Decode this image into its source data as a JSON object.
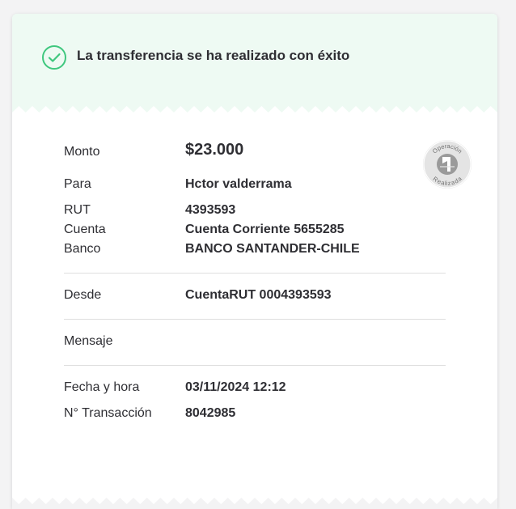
{
  "header": {
    "message": "La transferencia se ha realizado con éxito"
  },
  "stamp": {
    "top_text": "Operación",
    "bottom_text": "Realizada"
  },
  "details": {
    "monto_label": "Monto",
    "monto_value": "$23.000",
    "para_label": "Para",
    "para_value": "Hctor valderrama",
    "rut_label": "RUT",
    "rut_value": "4393593",
    "cuenta_label": "Cuenta",
    "cuenta_value": "Cuenta Corriente 5655285",
    "banco_label": "Banco",
    "banco_value": "BANCO SANTANDER-CHILE",
    "desde_label": "Desde",
    "desde_value": "CuentaRUT 0004393593",
    "mensaje_label": "Mensaje",
    "mensaje_value": "",
    "fecha_label": "Fecha y hora",
    "fecha_value": "03/11/2024 12:12",
    "transaccion_label": "N° Transacción",
    "transaccion_value": "8042985"
  },
  "colors": {
    "header_bg": "#eefaf3",
    "success_green": "#3fc77e",
    "text": "#2e2e33",
    "divider": "#dedede",
    "stamp_gray": "#8c8c8c"
  }
}
